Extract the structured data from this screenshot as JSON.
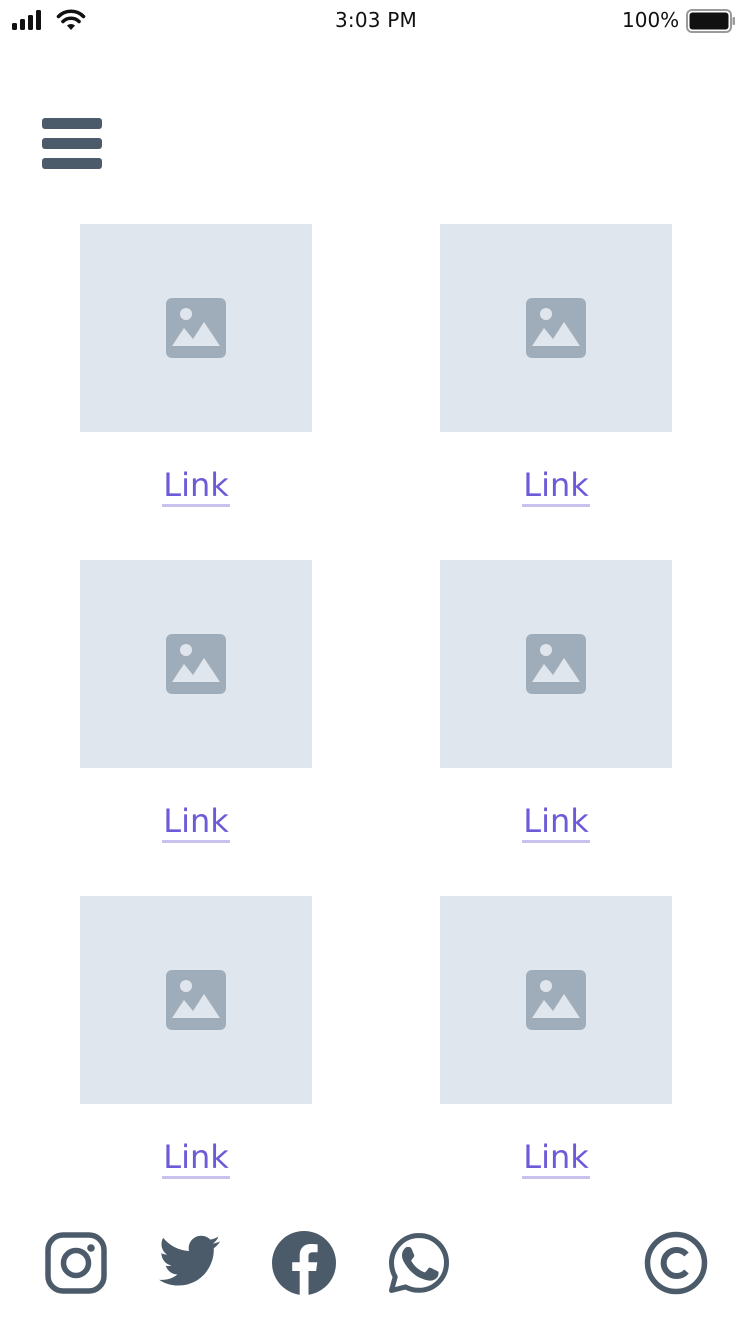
{
  "status_bar": {
    "time": "3:03 PM",
    "battery_percent": "100%",
    "battery_level": 1.0,
    "icons": [
      "signal-icon",
      "wifi-icon",
      "battery-icon"
    ]
  },
  "header": {
    "menu_icon": "hamburger-menu-icon"
  },
  "grid": {
    "items": [
      {
        "image_icon": "image-placeholder-icon",
        "link_label": "Link"
      },
      {
        "image_icon": "image-placeholder-icon",
        "link_label": "Link"
      },
      {
        "image_icon": "image-placeholder-icon",
        "link_label": "Link"
      },
      {
        "image_icon": "image-placeholder-icon",
        "link_label": "Link"
      },
      {
        "image_icon": "image-placeholder-icon",
        "link_label": "Link"
      },
      {
        "image_icon": "image-placeholder-icon",
        "link_label": "Link"
      }
    ]
  },
  "footer": {
    "icons": [
      "instagram-icon",
      "twitter-icon",
      "facebook-icon",
      "whatsapp-icon",
      "copyright-icon"
    ]
  },
  "colors": {
    "link": "#6b5bd6",
    "link_underline": "#c9c2f0",
    "placeholder_bg": "#e0e6ee",
    "placeholder_icon": "#9fadba",
    "icon_dark": "#4b5b6a"
  }
}
